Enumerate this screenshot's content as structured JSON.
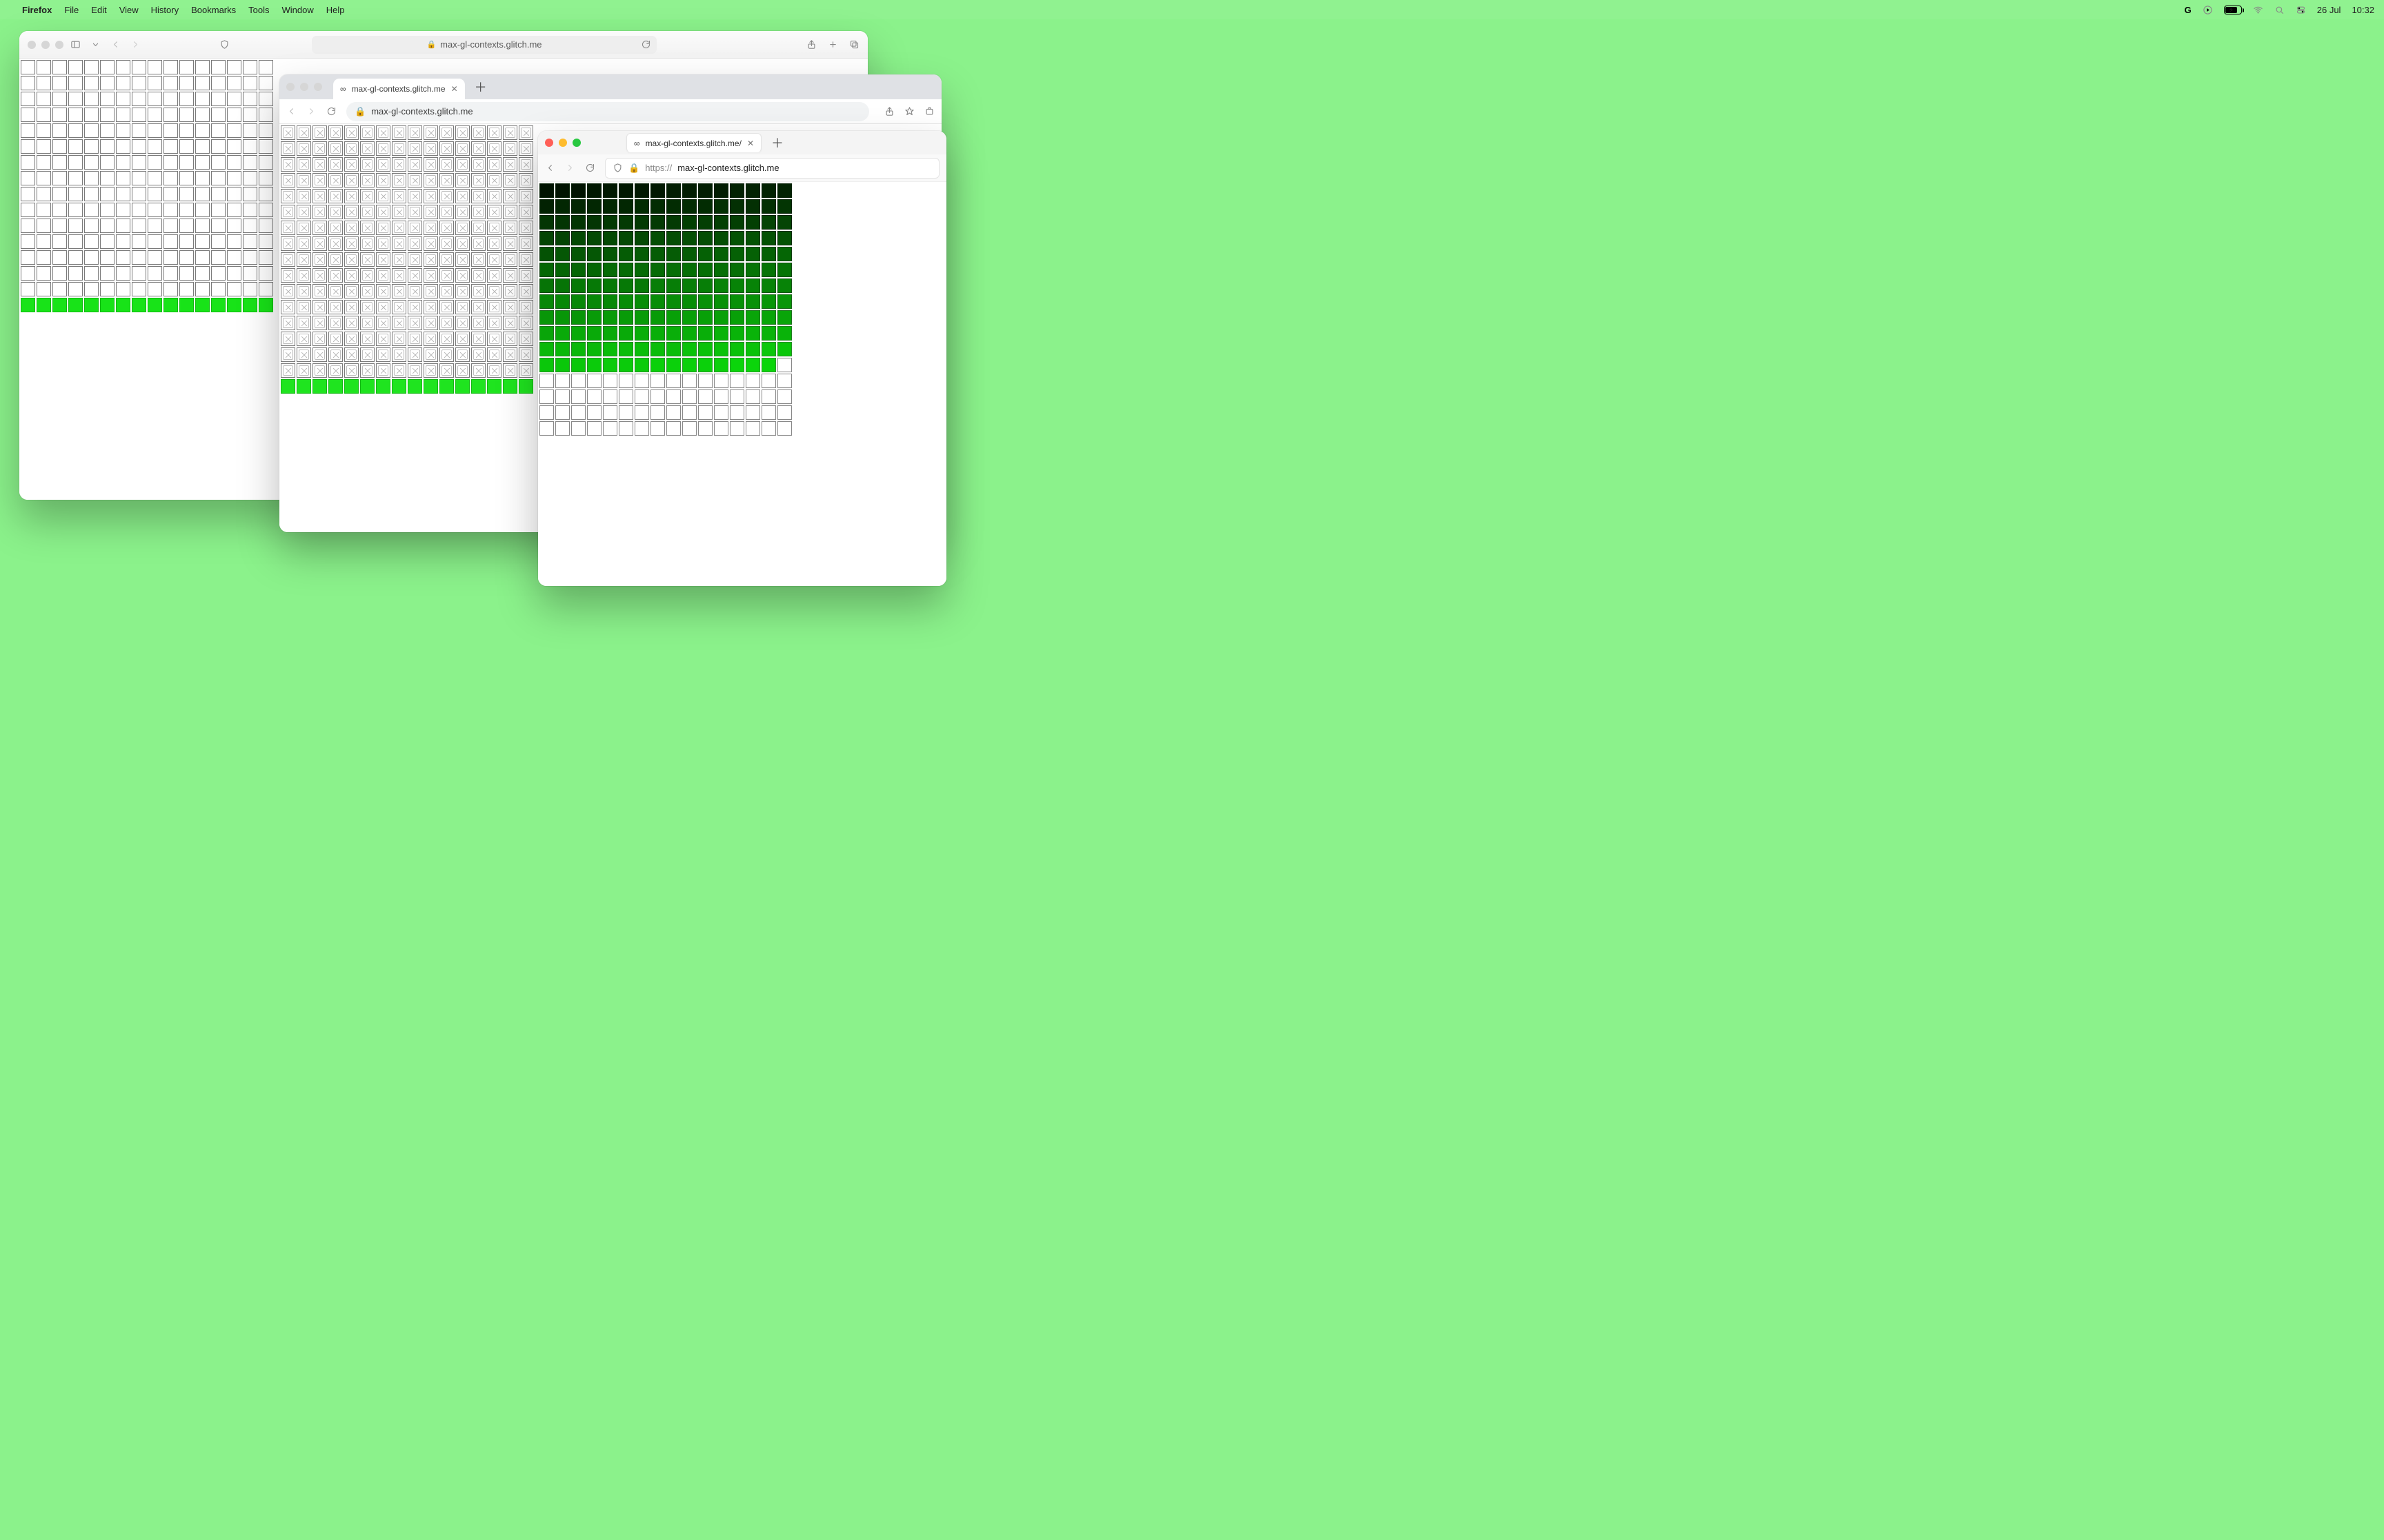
{
  "menubar": {
    "app": "Firefox",
    "items": [
      "File",
      "Edit",
      "View",
      "History",
      "Bookmarks",
      "Tools",
      "Window",
      "Help"
    ],
    "date": "26 Jul",
    "time": "10:32",
    "battery_percent": 78
  },
  "safari": {
    "url_display": "max-gl-contexts.glitch.me",
    "grid": {
      "cols": 16,
      "rows": 16,
      "green_rows": 1
    }
  },
  "chrome": {
    "tab_title": "max-gl-contexts.glitch.me",
    "url_display": "max-gl-contexts.glitch.me",
    "grid": {
      "cols": 16,
      "rows": 17,
      "broken_rows": 16,
      "green_rows": 1
    }
  },
  "firefox": {
    "tab_title": "max-gl-contexts.glitch.me/",
    "url_proto": "https://",
    "url_host": "max-gl-contexts.glitch.me",
    "grid": {
      "cols": 16,
      "rows": 16,
      "gradient_cells": 191
    }
  }
}
